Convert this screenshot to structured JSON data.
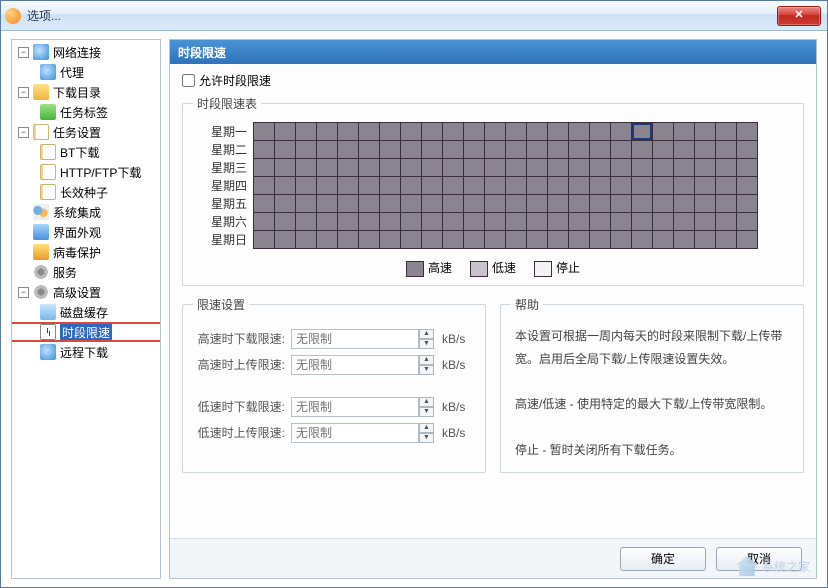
{
  "window": {
    "title": "选项..."
  },
  "tree": [
    {
      "label": "网络连接",
      "icon": "globe",
      "expandable": true,
      "children": [
        {
          "label": "代理",
          "icon": "globe"
        }
      ]
    },
    {
      "label": "下载目录",
      "icon": "folder",
      "expandable": true,
      "children": [
        {
          "label": "任务标签",
          "icon": "green"
        }
      ]
    },
    {
      "label": "任务设置",
      "icon": "page",
      "expandable": true,
      "children": [
        {
          "label": "BT下载",
          "icon": "page"
        },
        {
          "label": "HTTP/FTP下载",
          "icon": "page"
        },
        {
          "label": "长效种子",
          "icon": "page"
        }
      ]
    },
    {
      "label": "系统集成",
      "icon": "users",
      "expandable": false
    },
    {
      "label": "界面外观",
      "icon": "blue",
      "expandable": false
    },
    {
      "label": "病毒保护",
      "icon": "shield",
      "expandable": false
    },
    {
      "label": "服务",
      "icon": "gear",
      "expandable": false
    },
    {
      "label": "高级设置",
      "icon": "gear",
      "expandable": true,
      "children": [
        {
          "label": "磁盘缓存",
          "icon": "db"
        },
        {
          "label": "时段限速",
          "icon": "clock",
          "selected": true
        },
        {
          "label": "远程下载",
          "icon": "remote"
        }
      ]
    }
  ],
  "panel": {
    "title": "时段限速",
    "allow_label": "允许时段限速",
    "schedule_title": "时段限速表",
    "days": [
      "星期一",
      "星期二",
      "星期三",
      "星期四",
      "星期五",
      "星期六",
      "星期日"
    ],
    "cols": 24,
    "selected_cell": {
      "row": 0,
      "col": 18
    },
    "legend": {
      "high": "高速",
      "low": "低速",
      "stop": "停止"
    },
    "limits": {
      "title": "限速设置",
      "unit": "kB/s",
      "placeholder": "无限制",
      "rows": [
        {
          "label": "高速时下载限速:"
        },
        {
          "label": "高速时上传限速:"
        },
        {
          "label": "低速时下载限速:"
        },
        {
          "label": "低速时上传限速:"
        }
      ]
    },
    "help": {
      "title": "帮助",
      "p1": "本设置可根据一周内每天的时段来限制下载/上传带宽。启用后全局下载/上传限速设置失效。",
      "p2": "高速/低速 - 使用特定的最大下载/上传带宽限制。",
      "p3": "停止 - 暂时关闭所有下载任务。"
    }
  },
  "buttons": {
    "ok": "确定",
    "cancel": "取消"
  },
  "watermark": "系统之家"
}
